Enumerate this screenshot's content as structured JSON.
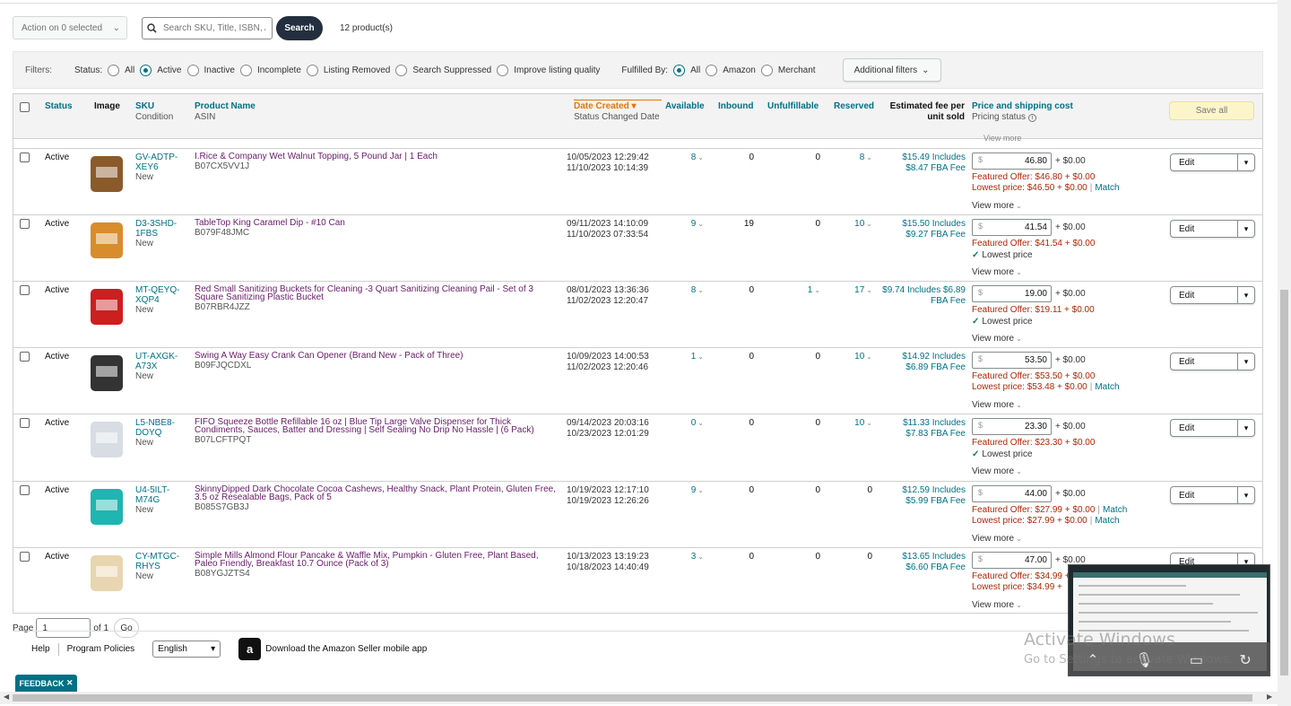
{
  "toolbar": {
    "action_label": "Action on 0 selected",
    "search_placeholder": "Search SKU, Title, ISBN, ASIN",
    "search_label": "Search",
    "product_count": "12 product(s)"
  },
  "filters": {
    "label": "Filters:",
    "status_label": "Status:",
    "status_options": [
      "All",
      "Active",
      "Inactive",
      "Incomplete",
      "Listing Removed",
      "Search Suppressed",
      "Improve listing quality"
    ],
    "status_selected": "Active",
    "fulfilled_label": "Fulfilled By:",
    "fulfilled_options": [
      "All",
      "Amazon",
      "Merchant"
    ],
    "fulfilled_selected": "All",
    "additional_label": "Additional filters"
  },
  "table": {
    "headers": {
      "status": "Status",
      "image": "Image",
      "sku": "SKU",
      "condition": "Condition",
      "product_name": "Product Name",
      "asin": "ASIN",
      "date_created": "Date Created",
      "status_changed": "Status Changed Date",
      "available": "Available",
      "inbound": "Inbound",
      "unfulfillable": "Unfulfillable",
      "reserved": "Reserved",
      "fee": "Estimated fee per unit sold",
      "price": "Price and shipping cost",
      "pricing_status": "Pricing status"
    },
    "save_all": "Save all",
    "peek_text": "View more",
    "rows": [
      {
        "status": "Active",
        "sku": "GV-ADTP-XEY6",
        "condition": "New",
        "name": "I.Rice & Company Wet Walnut Topping, 5 Pound Jar | 1 Each",
        "asin": "B07CX5VV1J",
        "created": "10/05/2023 12:29:42",
        "changed": "11/10/2023 10:14:39",
        "available": "8",
        "inbound": "0",
        "unfulfillable": "0",
        "reserved": "8",
        "fee1": "$15.49 Includes",
        "fee2": "$8.47 FBA Fee",
        "price": "46.80",
        "ship": "+ $0.00",
        "featured": "Featured Offer: $46.80 + $0.00",
        "lowest": "Lowest price: $46.50 + $0.00",
        "lowest_match": "Match",
        "lowest_ok": "",
        "edit": "Edit",
        "view_more": "View more",
        "img_color": "#8b5a2b"
      },
      {
        "status": "Active",
        "sku": "D3-3SHD-1FBS",
        "condition": "New",
        "name": "TableTop King Caramel Dip - #10 Can",
        "asin": "B079F48JMC",
        "created": "09/11/2023 14:10:09",
        "changed": "11/10/2023 07:33:54",
        "available": "9",
        "inbound": "19",
        "unfulfillable": "0",
        "reserved": "10",
        "fee1": "$15.50 Includes",
        "fee2": "$9.27 FBA Fee",
        "price": "41.54",
        "ship": "+ $0.00",
        "featured": "Featured Offer: $41.54 + $0.00",
        "lowest": "",
        "lowest_match": "",
        "lowest_ok": "Lowest price",
        "edit": "Edit",
        "view_more": "View more",
        "img_color": "#d98c2b"
      },
      {
        "status": "Active",
        "sku": "MT-QEYQ-XQP4",
        "condition": "New",
        "name": "Red Small Sanitizing Buckets for Cleaning -3 Quart Sanitizing Cleaning Pail - Set of 3 Square Sanitizing Plastic Bucket",
        "asin": "B07RBR4JZZ",
        "created": "08/01/2023 13:36:36",
        "changed": "11/02/2023 12:20:47",
        "available": "8",
        "inbound": "0",
        "unfulfillable": "1",
        "reserved": "17",
        "fee1": "$9.74 Includes $6.89",
        "fee2": "FBA Fee",
        "price": "19.00",
        "ship": "+ $0.00",
        "featured": "Featured Offer: $19.11 + $0.00",
        "lowest": "",
        "lowest_match": "",
        "lowest_ok": "Lowest price",
        "edit": "Edit",
        "view_more": "View more",
        "img_color": "#cc1f1f"
      },
      {
        "status": "Active",
        "sku": "UT-AXGK-A73X",
        "condition": "New",
        "name": "Swing A Way Easy Crank Can Opener (Brand New - Pack of Three)",
        "asin": "B09FJQCDXL",
        "created": "10/09/2023 14:00:53",
        "changed": "11/02/2023 12:20:46",
        "available": "1",
        "inbound": "0",
        "unfulfillable": "0",
        "reserved": "10",
        "fee1": "$14.92 Includes",
        "fee2": "$6.89 FBA Fee",
        "price": "53.50",
        "ship": "+ $0.00",
        "featured": "Featured Offer: $53.50 + $0.00",
        "lowest": "Lowest price: $53.48 + $0.00",
        "lowest_match": "Match",
        "lowest_ok": "",
        "edit": "Edit",
        "view_more": "View more",
        "img_color": "#333333"
      },
      {
        "status": "Active",
        "sku": "L5-NBE8-DOYQ",
        "condition": "New",
        "name": "FIFO Squeeze Bottle Refillable 16 oz | Blue Tip Large Valve Dispenser for Thick Condiments, Sauces, Batter and Dressing | Self Sealing No Drip No Hassle | (6 Pack)",
        "asin": "B07LCFTPQT",
        "created": "09/14/2023 20:03:16",
        "changed": "10/23/2023 12:01:29",
        "available": "0",
        "inbound": "0",
        "unfulfillable": "0",
        "reserved": "10",
        "fee1": "$11.33 Includes",
        "fee2": "$7.83 FBA Fee",
        "price": "23.30",
        "ship": "+ $0.00",
        "featured": "Featured Offer: $23.30 + $0.00",
        "lowest": "",
        "lowest_match": "",
        "lowest_ok": "Lowest price",
        "edit": "Edit",
        "view_more": "View more",
        "img_color": "#d7dde3"
      },
      {
        "status": "Active",
        "sku": "U4-5ILT-M74G",
        "condition": "New",
        "name": "SkinnyDipped Dark Chocolate Cocoa Cashews, Healthy Snack, Plant Protein, Gluten Free, 3.5 oz Resealable Bags, Pack of 5",
        "asin": "B085S7GB3J",
        "created": "10/19/2023 12:17:10",
        "changed": "10/19/2023 12:26:26",
        "available": "9",
        "inbound": "0",
        "unfulfillable": "0",
        "reserved": "0",
        "fee1": "$12.59 Includes",
        "fee2": "$5.99 FBA Fee",
        "price": "44.00",
        "ship": "+ $0.00",
        "featured": "Featured Offer: $27.99 + $0.00",
        "featured_match": "Match",
        "lowest": "Lowest price: $27.99 + $0.00",
        "lowest_match": "Match",
        "lowest_ok": "",
        "edit": "Edit",
        "view_more": "View more",
        "img_color": "#1fb5b0"
      },
      {
        "status": "Active",
        "sku": "CY-MTGC-RHYS",
        "condition": "New",
        "name": "Simple Mills Almond Flour Pancake & Waffle Mix, Pumpkin - Gluten Free, Plant Based, Paleo Friendly, Breakfast 10.7 Ounce (Pack of 3)",
        "asin": "B08YGJZTS4",
        "created": "10/13/2023 13:19:23",
        "changed": "10/18/2023 14:40:49",
        "available": "3",
        "inbound": "0",
        "unfulfillable": "0",
        "reserved": "0",
        "fee1": "$13.65 Includes",
        "fee2": "$6.60 FBA Fee",
        "price": "47.00",
        "ship": "+ $0.00",
        "featured": "Featured Offer: $34.99 +",
        "lowest": "Lowest price: $34.99 +",
        "lowest_match": "",
        "lowest_ok": "",
        "edit": "Edit",
        "view_more": "View more",
        "img_color": "#e8d6b0"
      }
    ]
  },
  "pager": {
    "label": "Page",
    "value": "1",
    "of": "of 1",
    "go": "Go"
  },
  "footer": {
    "help": "Help",
    "policies": "Program Policies",
    "language": "English",
    "app_icon": "a",
    "app_link": "Download the Amazon Seller mobile app"
  },
  "feedback": "FEEDBACK",
  "watermark": {
    "line1": "Activate Windows",
    "line2": "Go to Settings to activate Windows."
  },
  "colors": {
    "teal": "#007185",
    "dark": "#232f3e",
    "price_red": "#b12704",
    "orange": "#e77600"
  }
}
